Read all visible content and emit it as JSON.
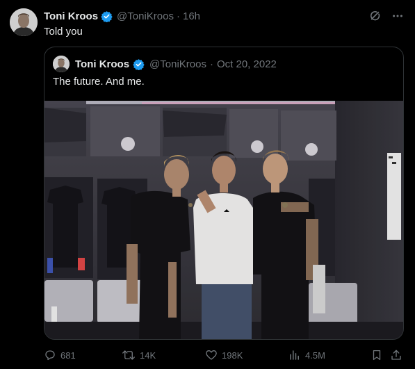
{
  "author": {
    "name": "Toni Kroos",
    "handle": "@ToniKroos",
    "separator": "·",
    "time": "16h",
    "verified": true
  },
  "tweet": {
    "text": "Told you"
  },
  "quoted": {
    "author": {
      "name": "Toni Kroos",
      "handle": "@ToniKroos",
      "separator": "·",
      "date": "Oct 20, 2022",
      "verified": true
    },
    "text": "The future. And me."
  },
  "actions": {
    "replies": "681",
    "reposts": "14K",
    "likes": "198K",
    "views": "4.5M"
  },
  "icons": {
    "top": [
      "grok-icon",
      "more-icon"
    ],
    "bar": [
      "reply-icon",
      "retweet-icon",
      "like-icon",
      "views-icon",
      "bookmark-icon",
      "share-icon"
    ]
  },
  "colors": {
    "background": "#000000",
    "text": "#e7e9ea",
    "secondary": "#71767b",
    "border": "#2f3336",
    "verified": "#1d9bf0"
  }
}
